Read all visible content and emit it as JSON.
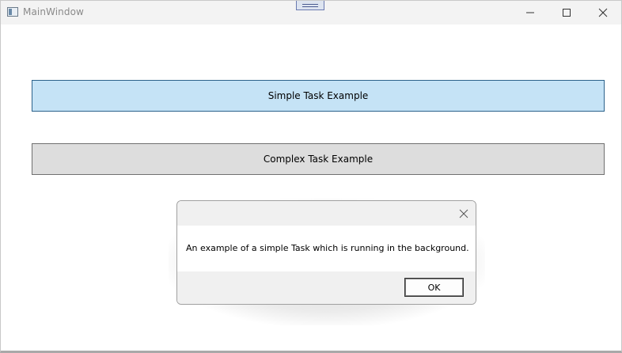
{
  "window": {
    "title": "MainWindow",
    "icon": "app-window-icon",
    "controls": [
      "minimize-icon",
      "maximize-icon",
      "close-icon"
    ]
  },
  "main": {
    "simple_button_label": "Simple Task Example",
    "complex_button_label": "Complex Task Example"
  },
  "dialog": {
    "message": "An example of a simple Task which is running in the background.",
    "ok_label": "OK",
    "close_icon": "close-icon"
  },
  "colors": {
    "simple_button_bg": "#c5e3f6",
    "simple_button_border": "#2c628b",
    "complex_button_bg": "#dddddd",
    "titlebar_bg": "#f3f3f3",
    "dialog_chrome_bg": "#f0f0f0"
  }
}
